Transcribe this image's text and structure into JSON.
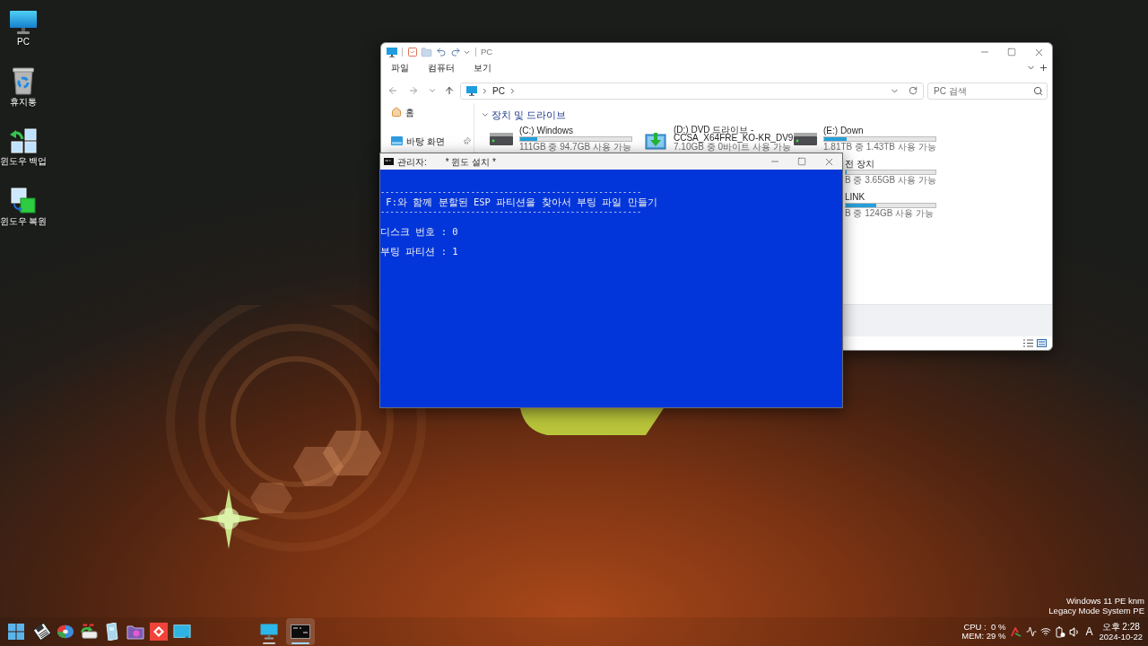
{
  "desktop": {
    "icons": [
      {
        "kind": "monitor",
        "label": "PC"
      },
      {
        "kind": "recycle-bin",
        "label": "휴지통"
      },
      {
        "kind": "backup",
        "label": "윈도우 백업"
      },
      {
        "kind": "restore",
        "label": "윈도우 복원"
      }
    ],
    "corner_text": [
      "Windows 11 PE knm",
      "Legacy Mode System PE"
    ]
  },
  "explorer": {
    "title": "PC",
    "menu": [
      "파일",
      "컴퓨터",
      "보기"
    ],
    "breadcrumb": [
      "PC"
    ],
    "search": {
      "placeholder": "PC 검색"
    },
    "sidebar": [
      {
        "kind": "home",
        "label": "홈",
        "pinned": false
      },
      {
        "kind": "desktop",
        "label": "바탕 화면",
        "pinned": true
      }
    ],
    "section": {
      "title": "장치 및 드라이브",
      "expanded": true
    },
    "drives": [
      {
        "kind": "hdd",
        "name_lines": [
          "(C:) Windows"
        ],
        "level": 0.15,
        "space": "111GB 중 94.7GB 사용 가능"
      },
      {
        "kind": "dvd",
        "name_lines": [
          "(D:) DVD 드라이브 -",
          "CCSA_X64FRE_KO-KR_DV9"
        ],
        "space": "7.10GB 중 0바이트 사용 가능"
      },
      {
        "kind": "hdd",
        "name_lines": [
          "(E:) Down"
        ],
        "level": 0.2,
        "space": "1.81TB 중 1.43TB 사용 가능"
      },
      {
        "kind": "covered",
        "name_lines": [
          "전 장치"
        ],
        "level": 0,
        "space": "B 중 3.65GB 사용 가능"
      },
      {
        "kind": "covered",
        "name_lines": [
          "LINK"
        ],
        "level": 0.34,
        "space": "B 중 124GB 사용 가능"
      }
    ]
  },
  "console": {
    "title": "관리자:",
    "caption": "* 윈도 설치 *",
    "lines": [
      {
        "kind": "rule",
        "text": "-------------------------------------------------------"
      },
      {
        "kind": "heading",
        "text": " F:와 함께 분할된 ESP 파티션을 찾아서 부팅 파일 만들기"
      },
      {
        "kind": "rule",
        "text": "-------------------------------------------------------"
      },
      {
        "kind": "field",
        "text": "디스크 번호 : 0"
      },
      {
        "kind": "field",
        "text": "부팅 파티션 : 1"
      }
    ]
  },
  "taskbar": {
    "pinned": [
      {
        "kind": "start"
      },
      {
        "kind": "diskette"
      },
      {
        "kind": "pie-disk"
      },
      {
        "kind": "drive-arrow"
      },
      {
        "kind": "tablet"
      },
      {
        "kind": "folder"
      },
      {
        "kind": "diamond-tile"
      },
      {
        "kind": "screen"
      }
    ],
    "running": [
      {
        "kind": "monitor",
        "active": false
      },
      {
        "kind": "terminal",
        "active": true
      }
    ],
    "cpu": "CPU :  0 %",
    "mem": "MEM: 29 %",
    "input_mode": "A",
    "time": "오후 2:28",
    "date": "2024-10-22"
  }
}
